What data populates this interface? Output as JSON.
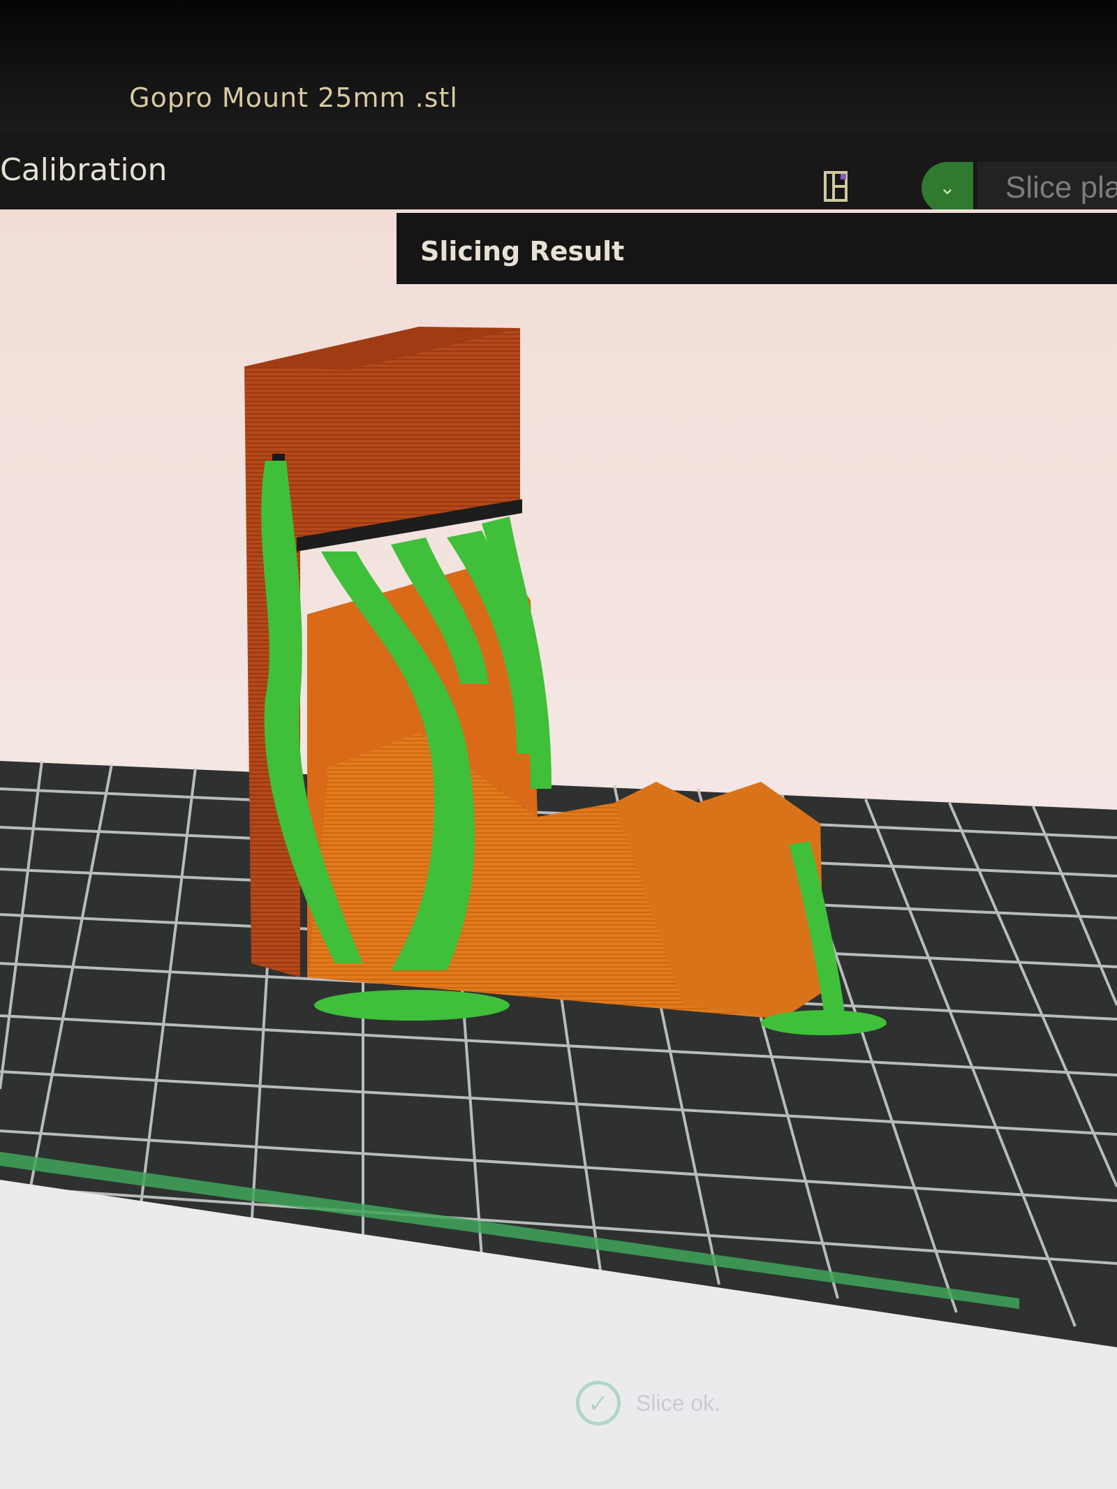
{
  "window": {
    "file_title": "Gopro Mount 25mm .stl"
  },
  "toolbar": {
    "tab_label": "Calibration",
    "layout_icon": "layout-icon",
    "dropdown_icon": "chevron-down-icon",
    "slice_button_label": "Slice pla"
  },
  "viewport": {
    "panel_title": "Slicing Result"
  },
  "status": {
    "icon": "check-circle-icon",
    "text": "Slice ok."
  },
  "colors": {
    "model_orange": "#e07a1c",
    "model_dark": "#b2461a",
    "support_green": "#3fbf3a",
    "bed_dark": "#2e3130",
    "bed_grid": "#c9cccc",
    "accent_green": "#2f7a2f"
  }
}
